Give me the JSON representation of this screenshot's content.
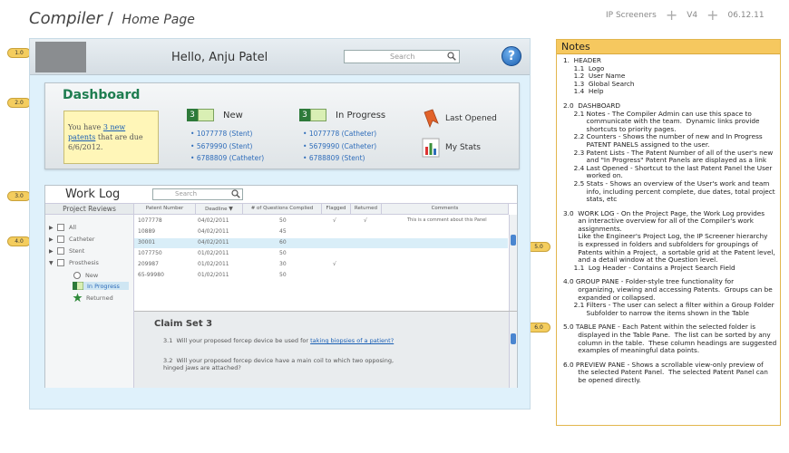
{
  "page": {
    "title": "Compiler",
    "subtitle": "Home Page",
    "screen_label": "IP Screeners",
    "version": "V4",
    "date": "06.12.11"
  },
  "markers": [
    "1.0",
    "2.0",
    "3.0",
    "4.0",
    "5.0",
    "6.0"
  ],
  "header": {
    "greeting": "Hello, Anju  Patel",
    "search_placeholder": "Search",
    "help_label": "?"
  },
  "dashboard": {
    "title": "Dashboard",
    "note": {
      "prefix": "You have ",
      "link": "3 new patents",
      "suffix": " that are due 6/6/2012."
    },
    "new": {
      "count": "3",
      "label": "New",
      "items": [
        "1077778  (Stent)",
        "5679990  (Stent)",
        "6788809  (Catheter)"
      ]
    },
    "in_progress": {
      "count": "3",
      "label": "In Progress",
      "items": [
        "1077778  (Catheter)",
        "5679990  (Catheter)",
        "6788809  (Stent)"
      ]
    },
    "last_opened": "Last Opened",
    "my_stats": "My Stats"
  },
  "worklog": {
    "title": "Work Log",
    "search_placeholder": "Search",
    "group": {
      "header": "Project Reviews",
      "items": [
        "All",
        "Catheter",
        "Stent",
        "Prosthesis"
      ],
      "sub": [
        "New",
        "In Progress",
        "Returned"
      ]
    },
    "columns": [
      "Patent Number",
      "Deadline",
      "# of Questions Complied",
      "Flagged",
      "Returned",
      "Comments"
    ],
    "rows": [
      {
        "patent": "1077778",
        "deadline": "04/02/2011",
        "questions": "50",
        "flagged": "√",
        "returned": "√",
        "comment": "This is a comment about this Panel"
      },
      {
        "patent": "10889",
        "deadline": "04/02/2011",
        "questions": "45",
        "flagged": "",
        "returned": "",
        "comment": ""
      },
      {
        "patent": "30001",
        "deadline": "04/02/2011",
        "questions": "60",
        "flagged": "",
        "returned": "",
        "comment": ""
      },
      {
        "patent": "1077750",
        "deadline": "01/02/2011",
        "questions": "50",
        "flagged": "",
        "returned": "",
        "comment": ""
      },
      {
        "patent": "209987",
        "deadline": "01/02/2011",
        "questions": "30",
        "flagged": "√",
        "returned": "",
        "comment": ""
      },
      {
        "patent": "65-99980",
        "deadline": "01/02/2011",
        "questions": "50",
        "flagged": "",
        "returned": "",
        "comment": ""
      }
    ],
    "preview": {
      "title": "Claim Set 3",
      "q1_num": "3.1",
      "q1_text": "Will your proposed forcep device be used for ",
      "q1_link": "taking biopsies of a patient?",
      "q2_num": "3.2",
      "q2_text": "Will your proposed forcep device have a main coil to which two opposing, hinged jaws are attached?"
    }
  },
  "notes": {
    "title": "Notes",
    "blocks": [
      "1.  HEADER\n     1.1  Logo\n     1.2  User Name\n     1.3  Global Search\n     1.4  Help",
      "2.0  DASHBOARD\n     2.1 Notes - The Compiler Admin can use this space to\n           communicate with the team.  Dynamic links provide\n           shortcuts to priority pages.\n     2.2 Counters - Shows the number of new and In Progress\n           PATENT PANELS assigned to the user.\n     2.3 Patent Lists - The Patent Number of all of the user's new\n           and \"In Progress\" Patent Panels are displayed as a link\n     2.4 Last Opened - Shortcut to the last Patent Panel the User\n           worked on.\n     2.5 Stats - Shows an overview of the User's work and team\n           info, including percent complete, due dates, total project\n           stats, etc",
      "3.0  WORK LOG - On the Project Page, the Work Log provides\n       an interactive overview for all of the Compiler's work\n       assignments.\n       Like the Engineer's Project Log, the IP Screener hierarchy\n       is expressed in folders and subfolders for groupings of\n       Patents within a Project,  a sortable grid at the Patent level,\n       and a detail window at the Question level.\n     1.1  Log Header - Contains a Project Search Field",
      "4.0 GROUP PANE - Folder-style tree functionality for\n       organizing, viewing and accessing Patents.  Groups can be\n       expanded or collapsed.\n     2.1 Filters - The user can select a filter within a Group Folder\n           Subfolder to narrow the items shown in the Table",
      "5.0 TABLE PANE - Each Patent within the selected folder is\n       displayed in the Table Pane.  The list can be sorted by any\n       column in the table.  These column headings are suggested\n       examples of meaningful data points.",
      "6.0 PREVIEW PANE - Shows a scrollable view-only preview of\n       the selected Patent Panel.  The selected Patent Panel can\n       be opened directly."
    ]
  }
}
